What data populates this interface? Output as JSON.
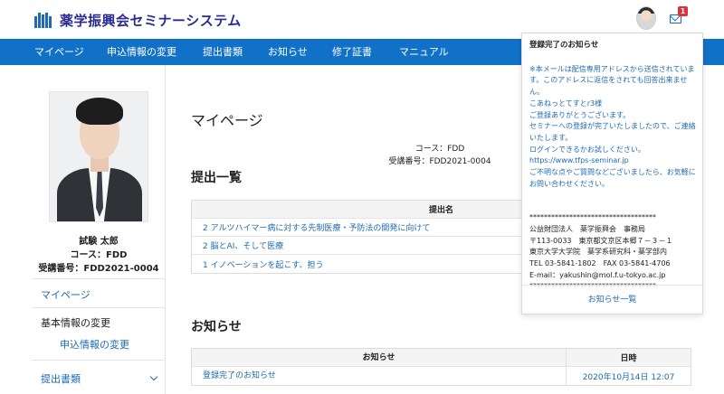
{
  "header": {
    "site_title": "薬学振興会セミナーシステム",
    "mail_badge": "1"
  },
  "nav": [
    "マイページ",
    "申込情報の変更",
    "提出書類",
    "お知らせ",
    "修了証書",
    "マニュアル"
  ],
  "sidebar": {
    "name": "試験 太郎",
    "course": "コース：FDD",
    "number": "受講番号：FDD2021-0004",
    "menu": {
      "mypage": "マイページ",
      "basic": "基本情報の変更",
      "application": "申込情報の変更",
      "documents": "提出書類"
    }
  },
  "main": {
    "page_title": "マイページ",
    "course": "コース：FDD",
    "number": "受講番号：FDD2021-0004",
    "submissions": {
      "title": "提出一覧",
      "header": "提出名",
      "rows": [
        "2 アルツハイマー病に対する先制医療・予防法の開発に向けて",
        "2 脳とAI、そして医療",
        "1 イノベーションを起こす、担う"
      ]
    },
    "notices": {
      "title": "お知らせ",
      "header_notice": "お知らせ",
      "header_date": "日時",
      "rows": [
        {
          "title": "登録完了のお知らせ",
          "date": "2020年10月14日 12:07"
        }
      ]
    }
  },
  "popup": {
    "title": "登録完了のお知らせ",
    "body": "※本メールは配信専用アドレスから送信されています。このアドレスに返信をされても回答出来ません。\nこあねっとてすとr3様\nご登録ありがとうございます。\nセミナーへの登録が完了いたしましたので、ご連絡いたします。\nログインできるかお試しください。\nhttps://www.tfps-seminar.jp\nご不明な点やご質問などございましたら、お気軽にお問い合わせください。\n\n***********************************\n公益財団法人　薬学振興会　事務局\n〒113-0033　東京都文京区本郷７－３－１\n東京大学大学院　薬学系研究科・薬学部内\nTEL 03-5841-1802　FAX 03-5841-4706\nE-mail：yakushin@mol.f.u-tokyo.ac.jp\n***********************************",
    "footer_link": "お知らせ一覧"
  }
}
